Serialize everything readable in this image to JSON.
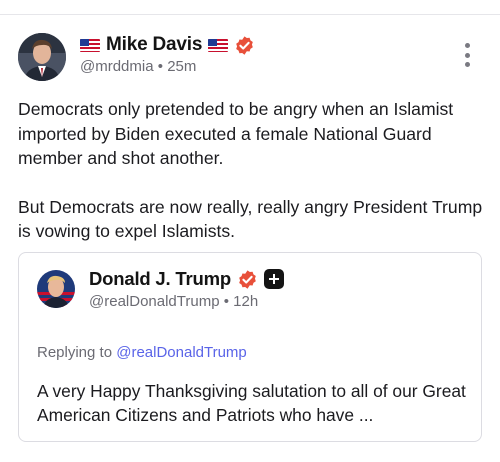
{
  "post": {
    "author": {
      "display_name": "Mike Davis",
      "handle": "@mrddmia",
      "separator": "•",
      "time": "25m",
      "flag_icon": "us-flag-icon",
      "verified_color": "#e8503a"
    },
    "paragraphs": [
      "Democrats only pretended to be angry when an Islamist imported by Biden executed a female National Guard member and shot another.",
      "But Democrats are now really, really angry President Trump is vowing to expel Islamists."
    ]
  },
  "quote": {
    "author": {
      "display_name": "Donald J. Trump",
      "handle": "@realDonaldTrump",
      "separator": "•",
      "time": "12h"
    },
    "replying_prefix": "Replying to",
    "replying_to": "@realDonaldTrump",
    "mention_color": "#5a64e8",
    "text": "A very Happy Thanksgiving salutation to all of our Great American Citizens and Patriots who have ..."
  }
}
